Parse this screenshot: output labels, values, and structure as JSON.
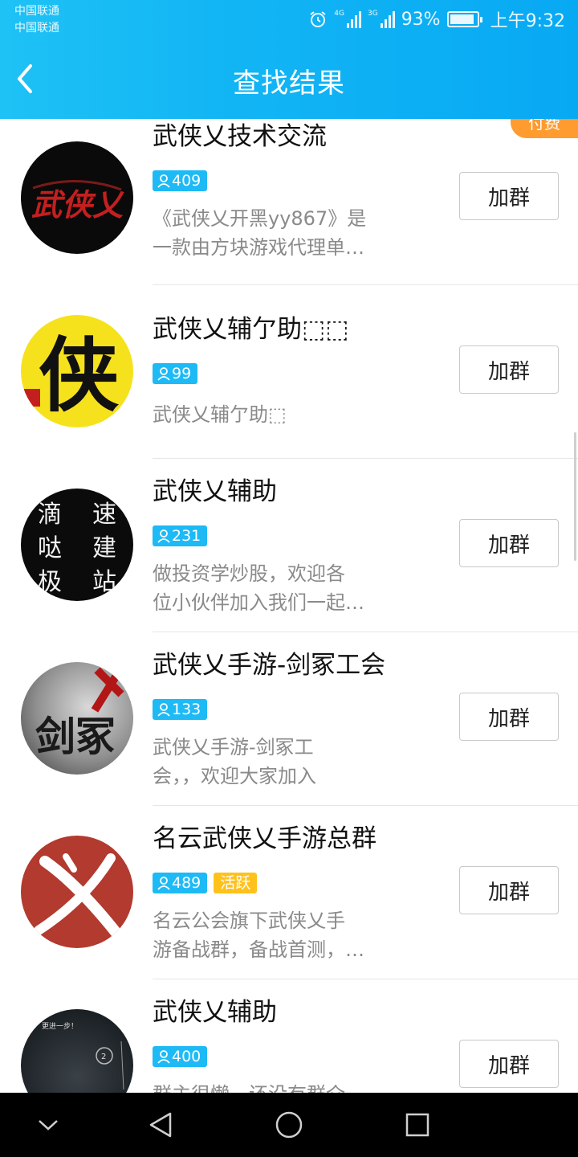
{
  "status": {
    "carrier1": "中国联通",
    "carrier2": "中国联通",
    "net1": "4G",
    "net2": "3G",
    "battery": "93%",
    "battery_level": 0.93,
    "time": "上午9:32"
  },
  "header": {
    "title": "查找结果"
  },
  "paid_tag": "付费",
  "join_label": "加群",
  "groups": [
    {
      "name": "武侠乂技术交流",
      "members": "409",
      "desc1": "《武侠乂开黑yy867》是",
      "desc2": "一款由方块游戏代理单…",
      "avatar_text": "武侠乂"
    },
    {
      "name": "武侠乂辅亇助⬚⬚",
      "members": "99",
      "desc1": "武侠乂辅亇助⬚",
      "desc2": "",
      "avatar_text": "侠"
    },
    {
      "name": "武侠乂辅助",
      "members": "231",
      "desc1": "做投资学炒股，欢迎各",
      "desc2": "位小伙伴加入我们一起…",
      "avatar_text": [
        "滴",
        "速",
        "哒",
        "建",
        "极",
        "站"
      ]
    },
    {
      "name": "武侠乂手游-剑冢工会",
      "members": "133",
      "desc1": "武侠乂手游-剑冢工",
      "desc2": "会，，欢迎大家加入",
      "avatar_text": "剑冢"
    },
    {
      "name": "名云武侠乂手游总群",
      "members": "489",
      "active": "活跃",
      "desc1": "名云公会旗下武侠乂手",
      "desc2": "游备战群，备战首测，…",
      "avatar_text": "乂"
    },
    {
      "name": "武侠乂辅助",
      "members": "400",
      "desc1": "群主很懒，还没有群介",
      "desc2": "",
      "avatar_text": "更进一步！"
    }
  ],
  "colors": {
    "header": "#12b5f4",
    "badge": "#1dbaf6",
    "active_badge": "#ffc21d",
    "paid": "#ff9b2f"
  },
  "icons": {
    "back": "chevron-left-icon",
    "member": "person-icon",
    "nav": [
      "chevron-down-icon",
      "back-triangle-icon",
      "home-circle-icon",
      "recents-square-icon"
    ]
  }
}
